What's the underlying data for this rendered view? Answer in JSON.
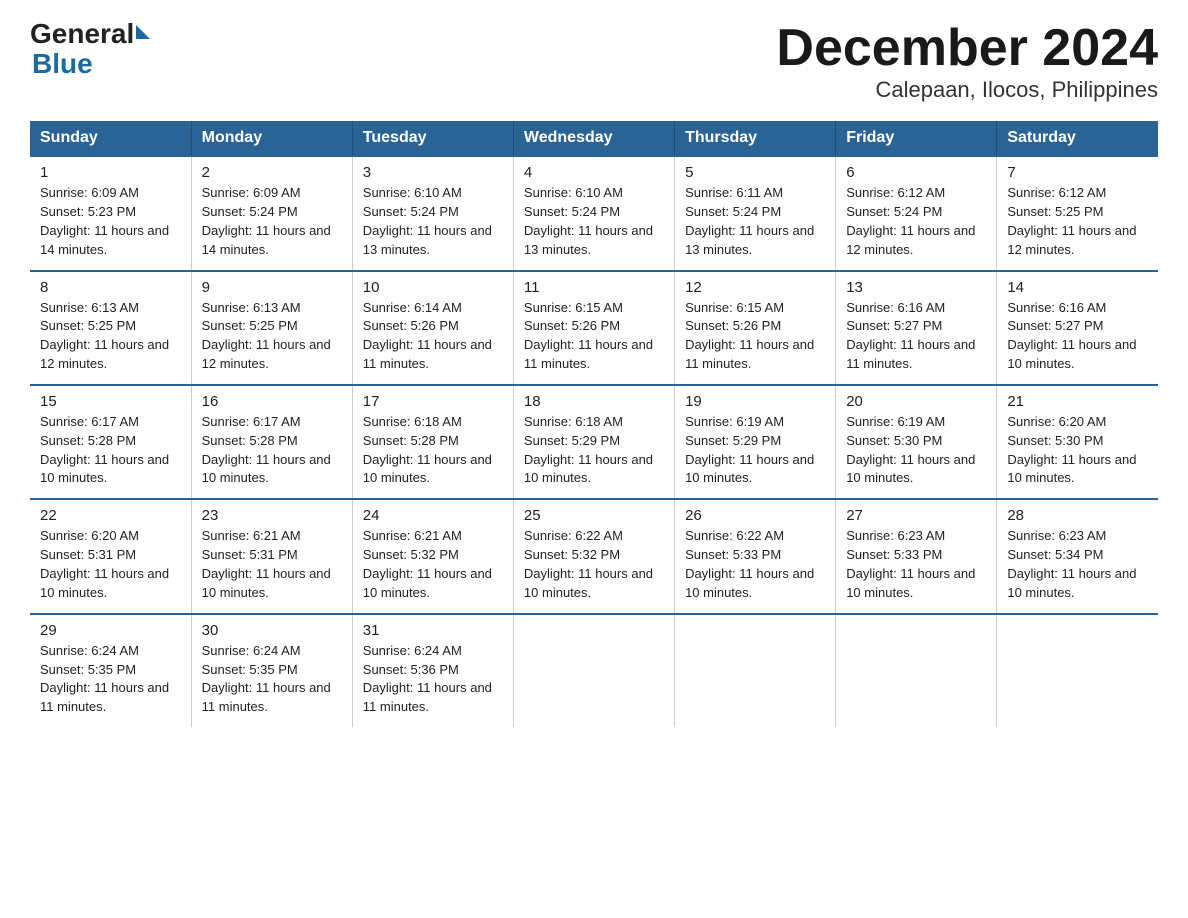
{
  "logo": {
    "general": "General",
    "blue": "Blue"
  },
  "header": {
    "title": "December 2024",
    "subtitle": "Calepaan, Ilocos, Philippines"
  },
  "days_of_week": [
    "Sunday",
    "Monday",
    "Tuesday",
    "Wednesday",
    "Thursday",
    "Friday",
    "Saturday"
  ],
  "weeks": [
    [
      {
        "day": "1",
        "sunrise": "6:09 AM",
        "sunset": "5:23 PM",
        "daylight": "11 hours and 14 minutes."
      },
      {
        "day": "2",
        "sunrise": "6:09 AM",
        "sunset": "5:24 PM",
        "daylight": "11 hours and 14 minutes."
      },
      {
        "day": "3",
        "sunrise": "6:10 AM",
        "sunset": "5:24 PM",
        "daylight": "11 hours and 13 minutes."
      },
      {
        "day": "4",
        "sunrise": "6:10 AM",
        "sunset": "5:24 PM",
        "daylight": "11 hours and 13 minutes."
      },
      {
        "day": "5",
        "sunrise": "6:11 AM",
        "sunset": "5:24 PM",
        "daylight": "11 hours and 13 minutes."
      },
      {
        "day": "6",
        "sunrise": "6:12 AM",
        "sunset": "5:24 PM",
        "daylight": "11 hours and 12 minutes."
      },
      {
        "day": "7",
        "sunrise": "6:12 AM",
        "sunset": "5:25 PM",
        "daylight": "11 hours and 12 minutes."
      }
    ],
    [
      {
        "day": "8",
        "sunrise": "6:13 AM",
        "sunset": "5:25 PM",
        "daylight": "11 hours and 12 minutes."
      },
      {
        "day": "9",
        "sunrise": "6:13 AM",
        "sunset": "5:25 PM",
        "daylight": "11 hours and 12 minutes."
      },
      {
        "day": "10",
        "sunrise": "6:14 AM",
        "sunset": "5:26 PM",
        "daylight": "11 hours and 11 minutes."
      },
      {
        "day": "11",
        "sunrise": "6:15 AM",
        "sunset": "5:26 PM",
        "daylight": "11 hours and 11 minutes."
      },
      {
        "day": "12",
        "sunrise": "6:15 AM",
        "sunset": "5:26 PM",
        "daylight": "11 hours and 11 minutes."
      },
      {
        "day": "13",
        "sunrise": "6:16 AM",
        "sunset": "5:27 PM",
        "daylight": "11 hours and 11 minutes."
      },
      {
        "day": "14",
        "sunrise": "6:16 AM",
        "sunset": "5:27 PM",
        "daylight": "11 hours and 10 minutes."
      }
    ],
    [
      {
        "day": "15",
        "sunrise": "6:17 AM",
        "sunset": "5:28 PM",
        "daylight": "11 hours and 10 minutes."
      },
      {
        "day": "16",
        "sunrise": "6:17 AM",
        "sunset": "5:28 PM",
        "daylight": "11 hours and 10 minutes."
      },
      {
        "day": "17",
        "sunrise": "6:18 AM",
        "sunset": "5:28 PM",
        "daylight": "11 hours and 10 minutes."
      },
      {
        "day": "18",
        "sunrise": "6:18 AM",
        "sunset": "5:29 PM",
        "daylight": "11 hours and 10 minutes."
      },
      {
        "day": "19",
        "sunrise": "6:19 AM",
        "sunset": "5:29 PM",
        "daylight": "11 hours and 10 minutes."
      },
      {
        "day": "20",
        "sunrise": "6:19 AM",
        "sunset": "5:30 PM",
        "daylight": "11 hours and 10 minutes."
      },
      {
        "day": "21",
        "sunrise": "6:20 AM",
        "sunset": "5:30 PM",
        "daylight": "11 hours and 10 minutes."
      }
    ],
    [
      {
        "day": "22",
        "sunrise": "6:20 AM",
        "sunset": "5:31 PM",
        "daylight": "11 hours and 10 minutes."
      },
      {
        "day": "23",
        "sunrise": "6:21 AM",
        "sunset": "5:31 PM",
        "daylight": "11 hours and 10 minutes."
      },
      {
        "day": "24",
        "sunrise": "6:21 AM",
        "sunset": "5:32 PM",
        "daylight": "11 hours and 10 minutes."
      },
      {
        "day": "25",
        "sunrise": "6:22 AM",
        "sunset": "5:32 PM",
        "daylight": "11 hours and 10 minutes."
      },
      {
        "day": "26",
        "sunrise": "6:22 AM",
        "sunset": "5:33 PM",
        "daylight": "11 hours and 10 minutes."
      },
      {
        "day": "27",
        "sunrise": "6:23 AM",
        "sunset": "5:33 PM",
        "daylight": "11 hours and 10 minutes."
      },
      {
        "day": "28",
        "sunrise": "6:23 AM",
        "sunset": "5:34 PM",
        "daylight": "11 hours and 10 minutes."
      }
    ],
    [
      {
        "day": "29",
        "sunrise": "6:24 AM",
        "sunset": "5:35 PM",
        "daylight": "11 hours and 11 minutes."
      },
      {
        "day": "30",
        "sunrise": "6:24 AM",
        "sunset": "5:35 PM",
        "daylight": "11 hours and 11 minutes."
      },
      {
        "day": "31",
        "sunrise": "6:24 AM",
        "sunset": "5:36 PM",
        "daylight": "11 hours and 11 minutes."
      },
      null,
      null,
      null,
      null
    ]
  ]
}
